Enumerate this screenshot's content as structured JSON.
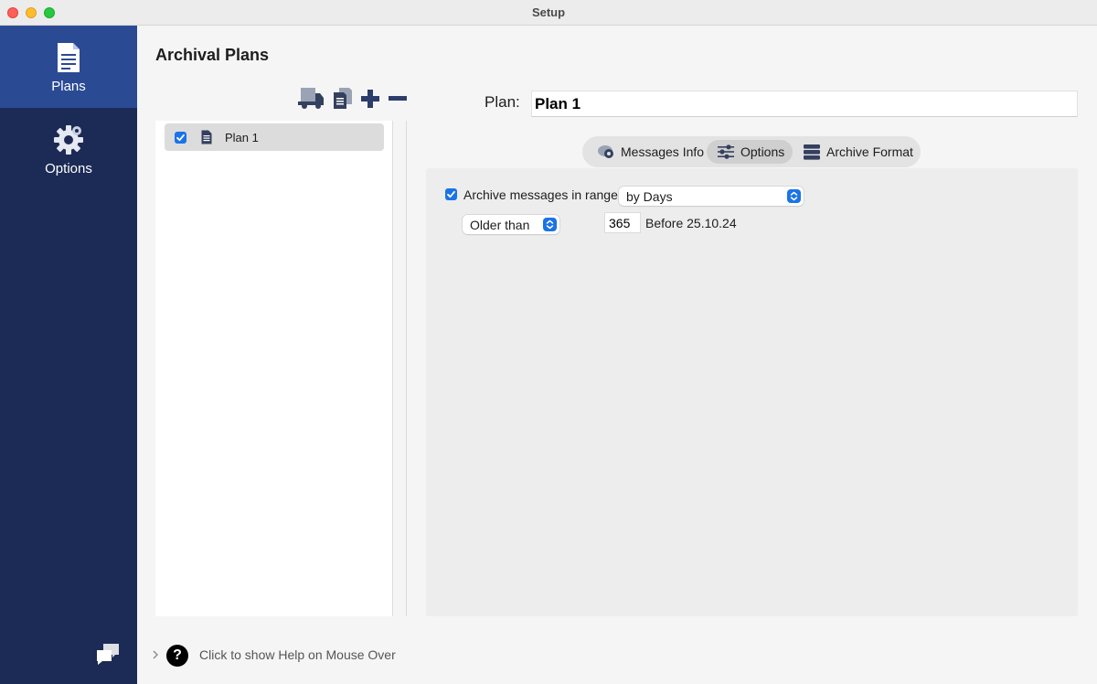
{
  "window": {
    "title": "Setup"
  },
  "sidebar": {
    "items": [
      {
        "label": "Plans",
        "icon": "document-icon",
        "active": true
      },
      {
        "label": "Options",
        "icon": "gear-icon",
        "active": false
      }
    ],
    "footer_icon": "chat-bubbles-icon"
  },
  "main": {
    "title": "Archival Plans",
    "toolbar_icons": [
      "truck-icon",
      "duplicate-icon",
      "plus-icon",
      "minus-icon"
    ],
    "plans": [
      {
        "name": "Plan 1",
        "checked": true,
        "selected": true
      }
    ],
    "plan_label": "Plan:",
    "plan_name": "Plan 1",
    "tabs": [
      {
        "label": "Messages Info",
        "icon": "messages-info-icon",
        "active": false
      },
      {
        "label": "Options",
        "icon": "sliders-icon",
        "active": true
      },
      {
        "label": "Archive Format",
        "icon": "database-icon",
        "active": false
      }
    ],
    "options": {
      "archive_range_label": "Archive messages in range:",
      "archive_range_checked": true,
      "range_select": "by Days",
      "comparison_select": "Older than",
      "days_value": "365",
      "before_text": "Before 25.10.24"
    },
    "help_text": "Click to show Help on Mouse Over"
  },
  "colors": {
    "sidebar_bg": "#1c2b55",
    "sidebar_active": "#2a4a94",
    "accent": "#1a73e8"
  }
}
